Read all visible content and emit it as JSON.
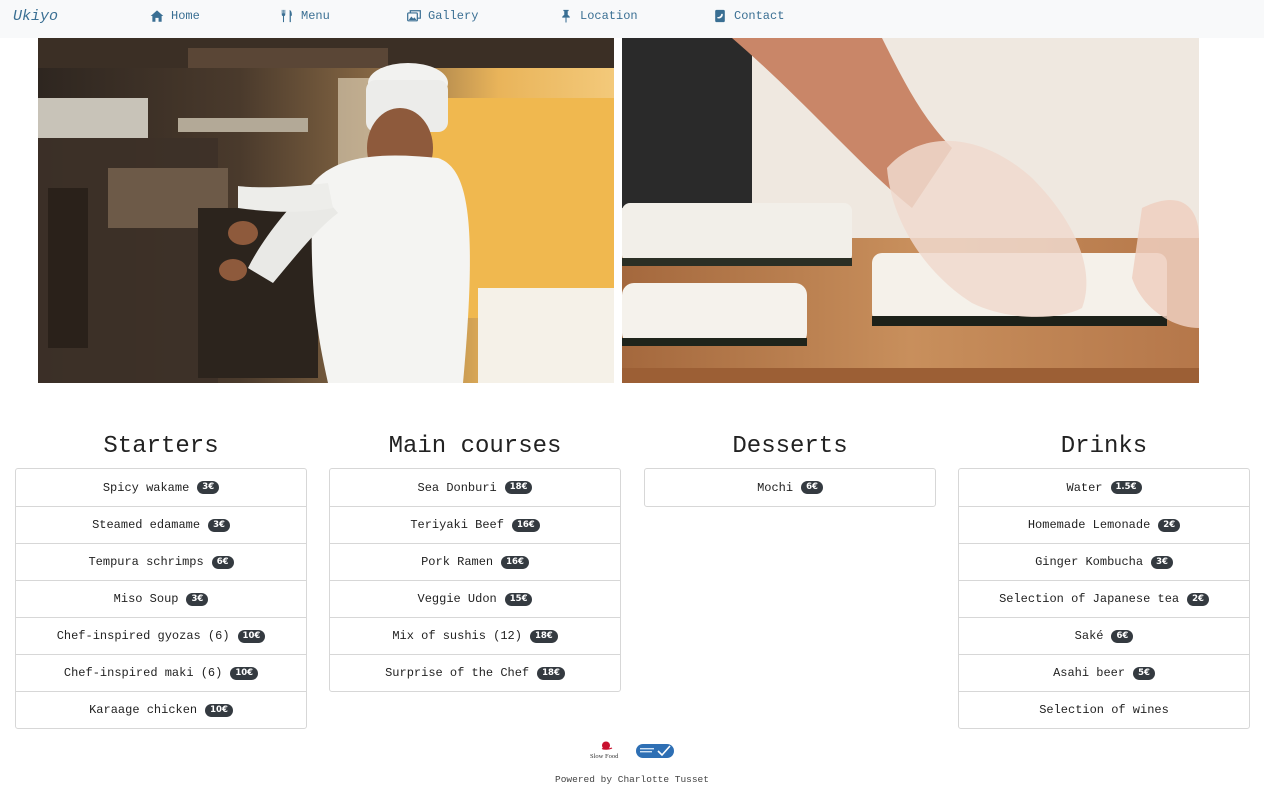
{
  "nav": {
    "brand": "Ukiyo",
    "links": [
      {
        "label": "Home",
        "icon": "home-icon"
      },
      {
        "label": "Menu",
        "icon": "cutlery-icon"
      },
      {
        "label": "Gallery",
        "icon": "gallery-icon"
      },
      {
        "label": "Location",
        "icon": "pin-icon"
      },
      {
        "label": "Contact",
        "icon": "contact-icon"
      }
    ],
    "link_color": "#3a6f93"
  },
  "photos": [
    {
      "subject": "chef-in-kitchen"
    },
    {
      "subject": "hands-rolling-sushi"
    }
  ],
  "menu": {
    "starters": {
      "title": "Starters",
      "items": [
        {
          "name": "Spicy wakame",
          "price": "3€"
        },
        {
          "name": "Steamed edamame",
          "price": "3€"
        },
        {
          "name": "Tempura schrimps",
          "price": "6€"
        },
        {
          "name": "Miso Soup",
          "price": "3€"
        },
        {
          "name": "Chef-inspired gyozas (6)",
          "price": "10€"
        },
        {
          "name": "Chef-inspired maki (6)",
          "price": "10€"
        },
        {
          "name": "Karaage chicken",
          "price": "10€"
        }
      ]
    },
    "mains": {
      "title": "Main courses",
      "items": [
        {
          "name": "Sea Donburi",
          "price": "18€"
        },
        {
          "name": "Teriyaki Beef",
          "price": "16€"
        },
        {
          "name": "Pork Ramen",
          "price": "16€"
        },
        {
          "name": "Veggie Udon",
          "price": "15€"
        },
        {
          "name": "Mix of sushis (12)",
          "price": "18€"
        },
        {
          "name": "Surprise of the Chef",
          "price": "18€"
        }
      ]
    },
    "desserts": {
      "title": "Desserts",
      "items": [
        {
          "name": "Mochi",
          "price": "6€"
        }
      ]
    },
    "drinks": {
      "title": "Drinks",
      "items": [
        {
          "name": "Water",
          "price": "1.5€"
        },
        {
          "name": "Homemade Lemonade",
          "price": "2€"
        },
        {
          "name": "Ginger Kombucha",
          "price": "3€"
        },
        {
          "name": "Selection of Japanese tea",
          "price": "2€"
        },
        {
          "name": "Saké",
          "price": "6€"
        },
        {
          "name": "Asahi beer",
          "price": "5€"
        },
        {
          "name": "Selection of wines",
          "price": ""
        }
      ]
    }
  },
  "footer": {
    "logos": [
      {
        "name": "slow-food-logo",
        "text": "Slow Food"
      },
      {
        "name": "msc-logo",
        "text": ""
      }
    ],
    "credit": "Powered by Charlotte Tusset"
  },
  "colors": {
    "badge_bg": "#343a40",
    "navbar_bg": "#f8f9fa",
    "border": "#d7d7d7"
  }
}
